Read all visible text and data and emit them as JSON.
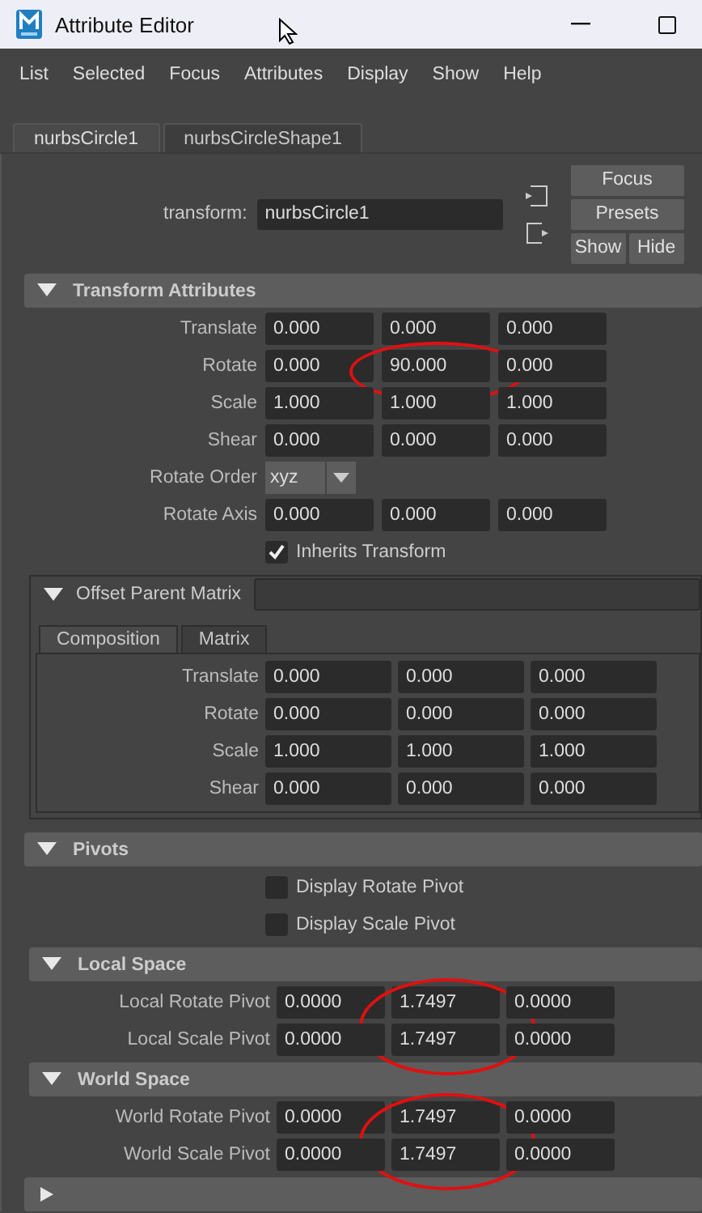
{
  "window": {
    "title": "Attribute Editor"
  },
  "menu": [
    "List",
    "Selected",
    "Focus",
    "Attributes",
    "Display",
    "Show",
    "Help"
  ],
  "tabs": [
    {
      "label": "nurbsCircle1",
      "selected": true
    },
    {
      "label": "nurbsCircleShape1",
      "selected": false
    }
  ],
  "node": {
    "label": "transform:",
    "value": "nurbsCircle1"
  },
  "buttons": [
    {
      "label": "Focus",
      "kind": "full"
    },
    {
      "label": "Presets",
      "kind": "full"
    },
    {
      "label": "Show",
      "kind": "half"
    },
    {
      "label": "Hide",
      "kind": "half"
    }
  ],
  "transform_attributes": {
    "title": "Transform Attributes",
    "expanded": true,
    "rows": [
      {
        "kind": "vector",
        "label": "Translate",
        "values": [
          {
            "text": "0.000",
            "circled": false
          },
          {
            "text": "0.000",
            "circled": false
          },
          {
            "text": "0.000",
            "circled": false
          }
        ]
      },
      {
        "kind": "vector",
        "label": "Rotate",
        "values": [
          {
            "text": "0.000",
            "circled": false
          },
          {
            "text": "90.000",
            "circled": true
          },
          {
            "text": "0.000",
            "circled": false
          }
        ]
      },
      {
        "kind": "vector",
        "label": "Scale",
        "values": [
          {
            "text": "1.000",
            "circled": false
          },
          {
            "text": "1.000",
            "circled": false
          },
          {
            "text": "1.000",
            "circled": false
          }
        ]
      },
      {
        "kind": "vector",
        "label": "Shear",
        "values": [
          {
            "text": "0.000",
            "circled": false
          },
          {
            "text": "0.000",
            "circled": false
          },
          {
            "text": "0.000",
            "circled": false
          }
        ]
      },
      {
        "kind": "enum",
        "label": "Rotate Order",
        "value": "xyz"
      },
      {
        "kind": "vector",
        "label": "Rotate Axis",
        "values": [
          {
            "text": "0.000",
            "circled": false
          },
          {
            "text": "0.000",
            "circled": false
          },
          {
            "text": "0.000",
            "circled": false
          }
        ]
      },
      {
        "kind": "checkbox",
        "label": "Inherits Transform",
        "checked": true
      }
    ]
  },
  "offset_parent_matrix": {
    "title": "Offset Parent Matrix",
    "expanded": true,
    "tabs": [
      {
        "label": "Composition",
        "selected": true
      },
      {
        "label": "Matrix",
        "selected": false
      }
    ],
    "rows": [
      {
        "kind": "vector",
        "label": "Translate",
        "values": [
          {
            "text": "0.000",
            "circled": false
          },
          {
            "text": "0.000",
            "circled": false
          },
          {
            "text": "0.000",
            "circled": false
          }
        ]
      },
      {
        "kind": "vector",
        "label": "Rotate",
        "values": [
          {
            "text": "0.000",
            "circled": false
          },
          {
            "text": "0.000",
            "circled": false
          },
          {
            "text": "0.000",
            "circled": false
          }
        ]
      },
      {
        "kind": "vector",
        "label": "Scale",
        "values": [
          {
            "text": "1.000",
            "circled": false
          },
          {
            "text": "1.000",
            "circled": false
          },
          {
            "text": "1.000",
            "circled": false
          }
        ]
      },
      {
        "kind": "vector",
        "label": "Shear",
        "values": [
          {
            "text": "0.000",
            "circled": false
          },
          {
            "text": "0.000",
            "circled": false
          },
          {
            "text": "0.000",
            "circled": false
          }
        ]
      }
    ]
  },
  "pivots": {
    "title": "Pivots",
    "expanded": true,
    "rows": [
      {
        "kind": "checkbox",
        "label": "Display Rotate Pivot",
        "checked": false
      },
      {
        "kind": "checkbox",
        "label": "Display Scale Pivot",
        "checked": false
      }
    ],
    "subsections": [
      {
        "title": "Local Space",
        "expanded": true,
        "rows": [
          {
            "kind": "vector",
            "label": "Local Rotate Pivot",
            "values": [
              {
                "text": "0.0000",
                "circled": false
              },
              {
                "text": "1.7497",
                "circled": true
              },
              {
                "text": "0.0000",
                "circled": false
              }
            ]
          },
          {
            "kind": "vector",
            "label": "Local Scale Pivot",
            "values": [
              {
                "text": "0.0000",
                "circled": false
              },
              {
                "text": "1.7497",
                "circled": true
              },
              {
                "text": "0.0000",
                "circled": false
              }
            ]
          }
        ]
      },
      {
        "title": "World Space",
        "expanded": true,
        "rows": [
          {
            "kind": "vector",
            "label": "World Rotate Pivot",
            "values": [
              {
                "text": "0.0000",
                "circled": false
              },
              {
                "text": "1.7497",
                "circled": true
              },
              {
                "text": "0.0000",
                "circled": false
              }
            ]
          },
          {
            "kind": "vector",
            "label": "World Scale Pivot",
            "values": [
              {
                "text": "0.0000",
                "circled": false
              },
              {
                "text": "1.7497",
                "circled": true
              },
              {
                "text": "0.0000",
                "circled": false
              }
            ]
          }
        ]
      }
    ]
  },
  "collapsed_section": {
    "expanded": false
  }
}
